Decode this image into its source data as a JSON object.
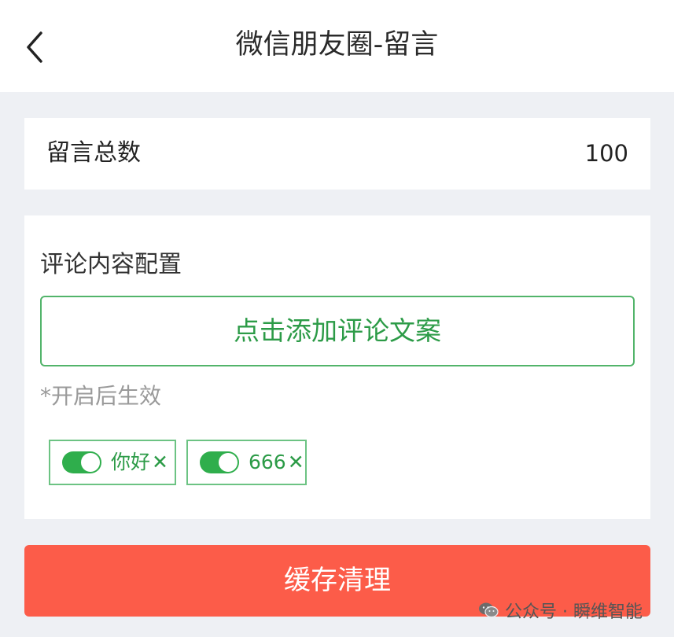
{
  "header": {
    "title": "微信朋友圈-留言",
    "back_icon": "chevron-left-icon"
  },
  "total": {
    "label": "留言总数",
    "value": "100"
  },
  "config": {
    "title": "评论内容配置",
    "add_button": "点击添加评论文案",
    "hint": "*开启后生效",
    "tags": [
      {
        "text": "你好",
        "enabled": true,
        "close": "✕"
      },
      {
        "text": "666",
        "enabled": true,
        "close": "✕"
      }
    ]
  },
  "actions": {
    "clear_cache": "缓存清理"
  },
  "watermark": {
    "text": "公众号 · 瞬维智能",
    "icon": "wechat-icon"
  },
  "colors": {
    "accent_green": "#2c9b47",
    "toggle_on": "#2fae4c",
    "danger_red": "#fc5c49",
    "page_bg": "#eef0f4"
  }
}
